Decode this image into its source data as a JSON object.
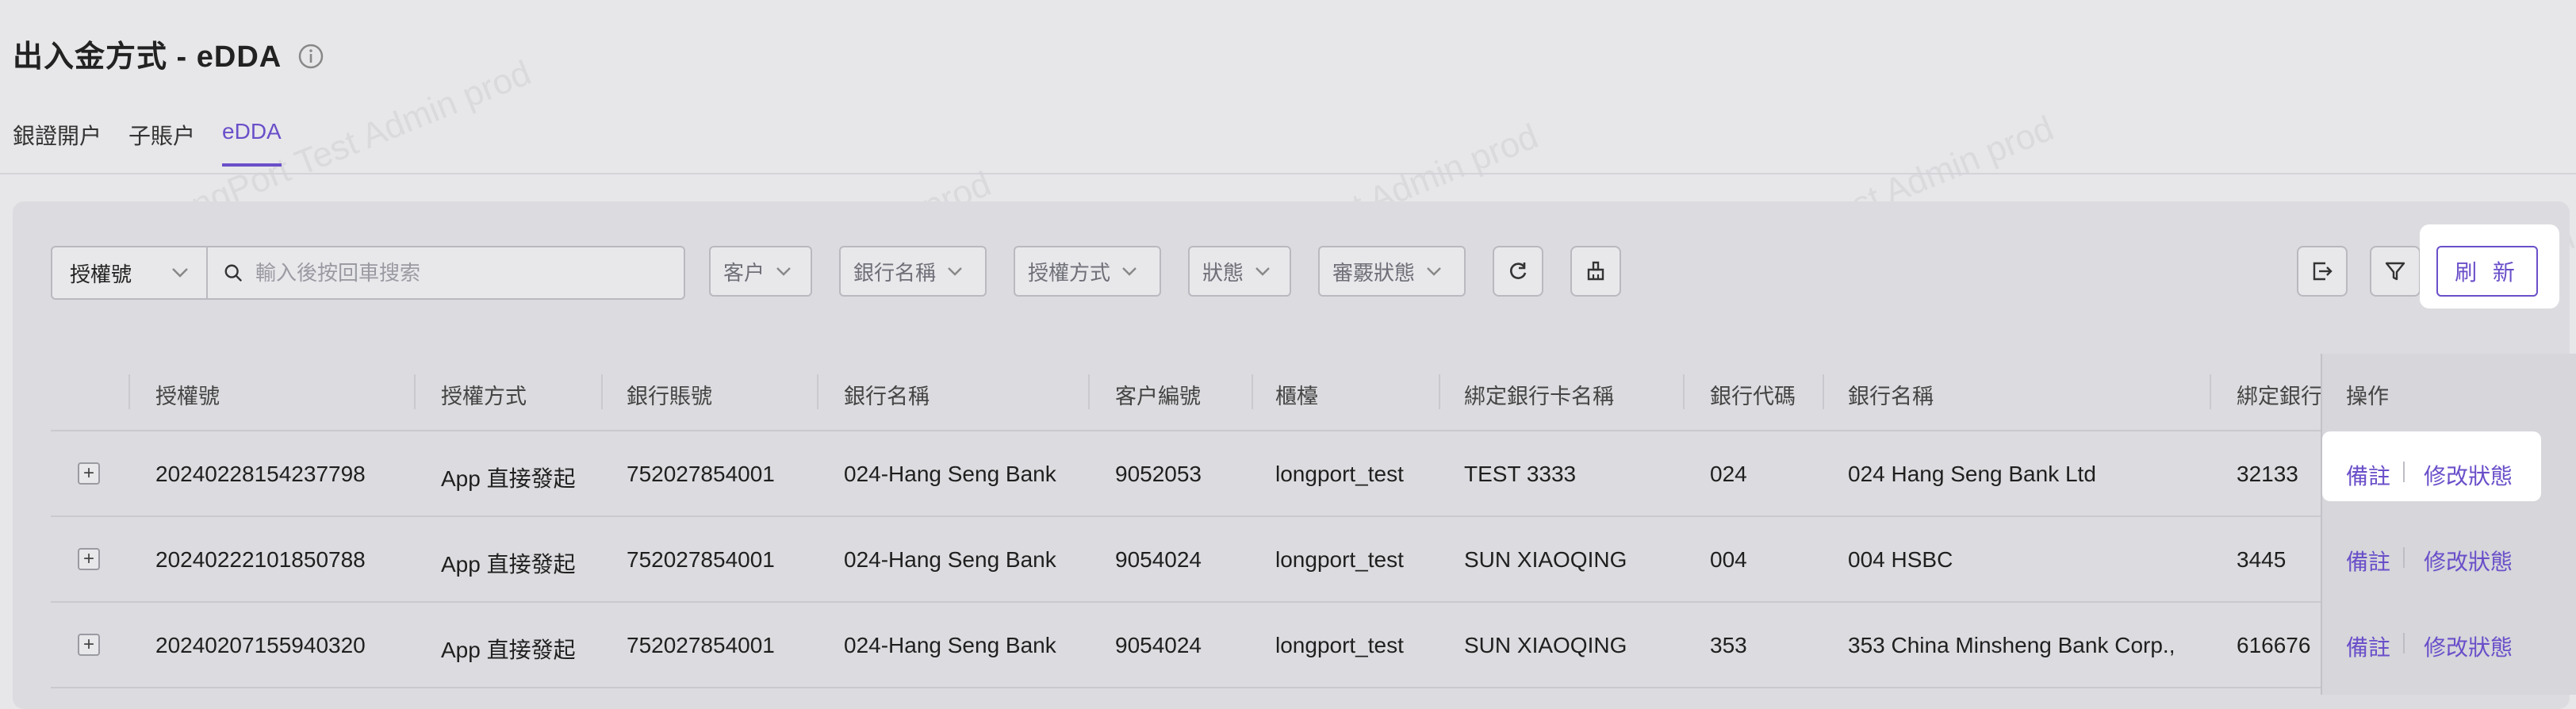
{
  "page": {
    "title": "出入金方式 - eDDA"
  },
  "tabs": [
    {
      "label": "銀證開户"
    },
    {
      "label": "子賬户"
    },
    {
      "label": "eDDA",
      "active": true
    }
  ],
  "toolbar": {
    "search_type": "授權號",
    "search_placeholder": "輸入後按回車搜索",
    "filters": [
      "客户",
      "銀行名稱",
      "授權方式",
      "狀態",
      "審覈狀態"
    ],
    "refresh_label": "刷 新"
  },
  "table": {
    "columns": [
      "授權號",
      "授權方式",
      "銀行賬號",
      "銀行名稱",
      "客户編號",
      "櫃檯",
      "綁定銀行卡名稱",
      "銀行代碼",
      "銀行名稱",
      "綁定銀行",
      "操作"
    ],
    "rows": [
      [
        "20240228154237798",
        "App 直接發起",
        "752027854001",
        "024-Hang Seng Bank",
        "9052053",
        "longport_test",
        "TEST 3333",
        "024",
        "024 Hang Seng Bank Ltd",
        "32133"
      ],
      [
        "20240222101850788",
        "App 直接發起",
        "752027854001",
        "024-Hang Seng Bank",
        "9054024",
        "longport_test",
        "SUN XIAOQING",
        "004",
        "004 HSBC",
        "3445"
      ],
      [
        "20240207155940320",
        "App 直接發起",
        "752027854001",
        "024-Hang Seng Bank",
        "9054024",
        "longport_test",
        "SUN XIAOQING",
        "353",
        "353 China Minsheng Bank Corp.,",
        "616676"
      ]
    ],
    "row_actions": [
      "備註",
      "修改狀態"
    ],
    "expand_symbol": "+"
  },
  "watermark": "LongPort Test Admin prod",
  "colors": {
    "accent": "#6a4fc9",
    "background": "#e7e7ea"
  }
}
